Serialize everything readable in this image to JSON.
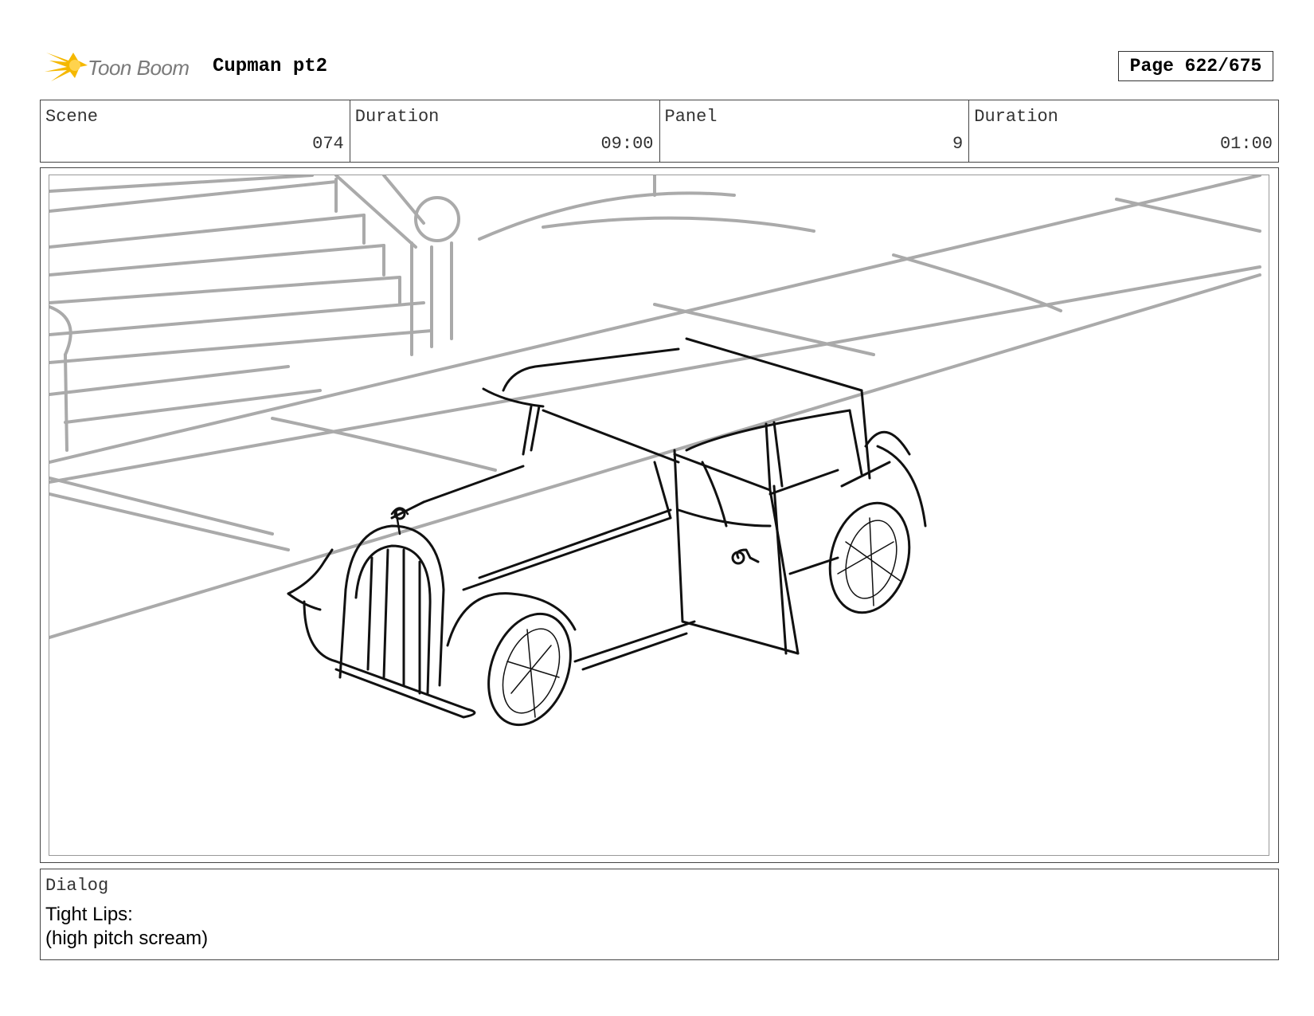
{
  "header": {
    "logo_text": "Toon Boom",
    "project_title": "Cupman pt2",
    "page": "Page 622/675"
  },
  "info": {
    "scene_label": "Scene",
    "scene_value": "074",
    "scene_duration_label": "Duration",
    "scene_duration_value": "09:00",
    "panel_label": "Panel",
    "panel_value": "9",
    "panel_duration_label": "Duration",
    "panel_duration_value": "01:00"
  },
  "dialog": {
    "label": "Dialog",
    "lines": [
      "Tight Lips:",
      "(high pitch scream)"
    ]
  },
  "colors": {
    "logo_yellow": "#f5b800",
    "sketch_background": "#aaaaaa",
    "sketch_foreground": "#111111"
  }
}
